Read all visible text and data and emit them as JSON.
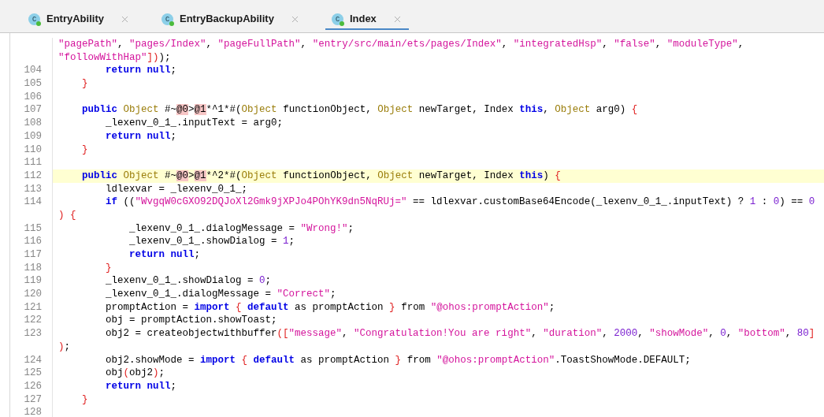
{
  "tabs": [
    {
      "label": "EntryAbility",
      "badge": "c",
      "selected": false
    },
    {
      "label": "EntryBackupAbility",
      "badge": "c",
      "selected": false
    },
    {
      "label": "Index",
      "badge": "c",
      "selected": true
    }
  ],
  "code_lines": [
    {
      "highlighted": false,
      "tokens": [
        {
          "kind": "string",
          "text": "\"pagePath\""
        },
        {
          "kind": "plain",
          "text": ", "
        },
        {
          "kind": "string",
          "text": "\"pages/Index\""
        },
        {
          "kind": "plain",
          "text": ", "
        },
        {
          "kind": "string",
          "text": "\"pageFullPath\""
        },
        {
          "kind": "plain",
          "text": ", "
        },
        {
          "kind": "string",
          "text": "\"entry/src/main/ets/pages/Index\""
        },
        {
          "kind": "plain",
          "text": ", "
        },
        {
          "kind": "string",
          "text": "\"integratedHsp\""
        },
        {
          "kind": "plain",
          "text": ", "
        },
        {
          "kind": "string",
          "text": "\"false\""
        },
        {
          "kind": "plain",
          "text": ", "
        },
        {
          "kind": "string",
          "text": "\"moduleType\""
        },
        {
          "kind": "plain",
          "text": ","
        }
      ]
    },
    {
      "highlighted": false,
      "tokens": [
        {
          "kind": "string",
          "text": "\"followWithHap\""
        },
        {
          "kind": "brace",
          "text": "])"
        },
        {
          "kind": "plain",
          "text": ");"
        }
      ]
    },
    {
      "number": "104",
      "highlighted": false,
      "tokens": [
        {
          "kind": "keyword",
          "text": "        return "
        },
        {
          "kind": "keyword",
          "text": "null"
        },
        {
          "kind": "plain",
          "text": ";"
        }
      ]
    },
    {
      "number": "105",
      "highlighted": false,
      "tokens": [
        {
          "kind": "brace",
          "text": "    }"
        }
      ]
    },
    {
      "number": "106",
      "highlighted": false
    },
    {
      "number": "107",
      "highlighted": false,
      "tokens": [
        {
          "kind": "keyword",
          "text": "    public "
        },
        {
          "kind": "type",
          "text": "Object"
        },
        {
          "kind": "plain",
          "text": " #~"
        },
        {
          "kind": "marked",
          "text": "@0"
        },
        {
          "kind": "plain",
          "text": ">"
        },
        {
          "kind": "marked",
          "text": "@1"
        },
        {
          "kind": "plain",
          "text": "*^1*#("
        },
        {
          "kind": "type",
          "text": "Object"
        },
        {
          "kind": "plain",
          "text": " functionObject, "
        },
        {
          "kind": "type",
          "text": "Object"
        },
        {
          "kind": "plain",
          "text": " newTarget, Index "
        },
        {
          "kind": "keyword",
          "text": "this"
        },
        {
          "kind": "plain",
          "text": ", "
        },
        {
          "kind": "type",
          "text": "Object"
        },
        {
          "kind": "plain",
          "text": " arg0) "
        },
        {
          "kind": "brace",
          "text": "{"
        }
      ]
    },
    {
      "number": "108",
      "highlighted": false,
      "tokens": [
        {
          "kind": "plain",
          "text": "        _lexenv_0_1_.inputText = arg0;"
        }
      ]
    },
    {
      "number": "109",
      "highlighted": false,
      "tokens": [
        {
          "kind": "keyword",
          "text": "        return "
        },
        {
          "kind": "keyword",
          "text": "null"
        },
        {
          "kind": "plain",
          "text": ";"
        }
      ]
    },
    {
      "number": "110",
      "highlighted": false,
      "tokens": [
        {
          "kind": "brace",
          "text": "    }"
        }
      ]
    },
    {
      "number": "111",
      "highlighted": false
    },
    {
      "number": "112",
      "highlighted": true,
      "tokens": [
        {
          "kind": "keyword",
          "text": "    public "
        },
        {
          "kind": "type",
          "text": "Object"
        },
        {
          "kind": "plain",
          "text": " #~"
        },
        {
          "kind": "marked",
          "text": "@0"
        },
        {
          "kind": "plain",
          "text": ">"
        },
        {
          "kind": "marked",
          "text": "@1"
        },
        {
          "kind": "plain",
          "text": "*^2*#("
        },
        {
          "kind": "type",
          "text": "Object"
        },
        {
          "kind": "plain",
          "text": " functionObject, "
        },
        {
          "kind": "type",
          "text": "Object"
        },
        {
          "kind": "plain",
          "text": " newTarget, Index "
        },
        {
          "kind": "keyword",
          "text": "this"
        },
        {
          "kind": "plain",
          "text": ") "
        },
        {
          "kind": "brace",
          "text": "{"
        }
      ]
    },
    {
      "number": "113",
      "highlighted": false,
      "tokens": [
        {
          "kind": "plain",
          "text": "        ldlexvar = _lexenv_0_1_;"
        }
      ]
    },
    {
      "number": "114",
      "highlighted": false,
      "tokens": [
        {
          "kind": "keyword",
          "text": "        if"
        },
        {
          "kind": "plain",
          "text": " (("
        },
        {
          "kind": "string",
          "text": "\"WvgqW0cGXO92DQJoXl2Gmk9jXPJo4POhYK9dn5NqRUj=\""
        },
        {
          "kind": "plain",
          "text": " == ldlexvar.customBase64Encode(_lexenv_0_1_.inputText) ? "
        },
        {
          "kind": "number",
          "text": "1"
        },
        {
          "kind": "plain",
          "text": " : "
        },
        {
          "kind": "number",
          "text": "0"
        },
        {
          "kind": "plain",
          "text": ") == "
        },
        {
          "kind": "number",
          "text": "0"
        }
      ]
    },
    {
      "highlighted": false,
      "tokens": [
        {
          "kind": "brace",
          "text": ") {"
        }
      ]
    },
    {
      "number": "115",
      "highlighted": false,
      "tokens": [
        {
          "kind": "plain",
          "text": "            _lexenv_0_1_.dialogMessage = "
        },
        {
          "kind": "string",
          "text": "\"Wrong!\""
        },
        {
          "kind": "plain",
          "text": ";"
        }
      ]
    },
    {
      "number": "116",
      "highlighted": false,
      "tokens": [
        {
          "kind": "plain",
          "text": "            _lexenv_0_1_.showDialog = "
        },
        {
          "kind": "number",
          "text": "1"
        },
        {
          "kind": "plain",
          "text": ";"
        }
      ]
    },
    {
      "number": "117",
      "highlighted": false,
      "tokens": [
        {
          "kind": "keyword",
          "text": "            return "
        },
        {
          "kind": "keyword",
          "text": "null"
        },
        {
          "kind": "plain",
          "text": ";"
        }
      ]
    },
    {
      "number": "118",
      "highlighted": false,
      "tokens": [
        {
          "kind": "brace",
          "text": "        }"
        }
      ]
    },
    {
      "number": "119",
      "highlighted": false,
      "tokens": [
        {
          "kind": "plain",
          "text": "        _lexenv_0_1_.showDialog = "
        },
        {
          "kind": "number",
          "text": "0"
        },
        {
          "kind": "plain",
          "text": ";"
        }
      ]
    },
    {
      "number": "120",
      "highlighted": false,
      "tokens": [
        {
          "kind": "plain",
          "text": "        _lexenv_0_1_.dialogMessage = "
        },
        {
          "kind": "string",
          "text": "\"Correct\""
        },
        {
          "kind": "plain",
          "text": ";"
        }
      ]
    },
    {
      "number": "121",
      "highlighted": false,
      "tokens": [
        {
          "kind": "plain",
          "text": "        promptAction = "
        },
        {
          "kind": "keyword",
          "text": "import "
        },
        {
          "kind": "brace",
          "text": "{ "
        },
        {
          "kind": "keyword",
          "text": "default"
        },
        {
          "kind": "plain",
          "text": " as promptAction "
        },
        {
          "kind": "brace",
          "text": "}"
        },
        {
          "kind": "plain",
          "text": " from "
        },
        {
          "kind": "string",
          "text": "\"@ohos:promptAction\""
        },
        {
          "kind": "plain",
          "text": ";"
        }
      ]
    },
    {
      "number": "122",
      "highlighted": false,
      "tokens": [
        {
          "kind": "plain",
          "text": "        obj = promptAction.showToast;"
        }
      ]
    },
    {
      "number": "123",
      "highlighted": false,
      "tokens": [
        {
          "kind": "plain",
          "text": "        obj2 = createobjectwithbuffer"
        },
        {
          "kind": "brace",
          "text": "(["
        },
        {
          "kind": "string",
          "text": "\"message\""
        },
        {
          "kind": "plain",
          "text": ", "
        },
        {
          "kind": "string",
          "text": "\"Congratulation!You are right\""
        },
        {
          "kind": "plain",
          "text": ", "
        },
        {
          "kind": "string",
          "text": "\"duration\""
        },
        {
          "kind": "plain",
          "text": ", "
        },
        {
          "kind": "number",
          "text": "2000"
        },
        {
          "kind": "plain",
          "text": ", "
        },
        {
          "kind": "string",
          "text": "\"showMode\""
        },
        {
          "kind": "plain",
          "text": ", "
        },
        {
          "kind": "number",
          "text": "0"
        },
        {
          "kind": "plain",
          "text": ", "
        },
        {
          "kind": "string",
          "text": "\"bottom\""
        },
        {
          "kind": "plain",
          "text": ", "
        },
        {
          "kind": "number",
          "text": "80"
        },
        {
          "kind": "brace",
          "text": "]"
        }
      ]
    },
    {
      "highlighted": false,
      "tokens": [
        {
          "kind": "brace",
          "text": ")"
        },
        {
          "kind": "plain",
          "text": ";"
        }
      ]
    },
    {
      "number": "124",
      "highlighted": false,
      "tokens": [
        {
          "kind": "plain",
          "text": "        obj2.showMode = "
        },
        {
          "kind": "keyword",
          "text": "import "
        },
        {
          "kind": "brace",
          "text": "{ "
        },
        {
          "kind": "keyword",
          "text": "default"
        },
        {
          "kind": "plain",
          "text": " as promptAction "
        },
        {
          "kind": "brace",
          "text": "}"
        },
        {
          "kind": "plain",
          "text": " from "
        },
        {
          "kind": "string",
          "text": "\"@ohos:promptAction\""
        },
        {
          "kind": "plain",
          "text": ".ToastShowMode.DEFAULT;"
        }
      ]
    },
    {
      "number": "125",
      "highlighted": false,
      "tokens": [
        {
          "kind": "plain",
          "text": "        obj"
        },
        {
          "kind": "brace",
          "text": "("
        },
        {
          "kind": "plain",
          "text": "obj2"
        },
        {
          "kind": "brace",
          "text": ")"
        },
        {
          "kind": "plain",
          "text": ";"
        }
      ]
    },
    {
      "number": "126",
      "highlighted": false,
      "tokens": [
        {
          "kind": "keyword",
          "text": "        return "
        },
        {
          "kind": "keyword",
          "text": "null"
        },
        {
          "kind": "plain",
          "text": ";"
        }
      ]
    },
    {
      "number": "127",
      "highlighted": false,
      "tokens": [
        {
          "kind": "brace",
          "text": "    }"
        }
      ]
    },
    {
      "number": "128",
      "highlighted": false
    }
  ]
}
